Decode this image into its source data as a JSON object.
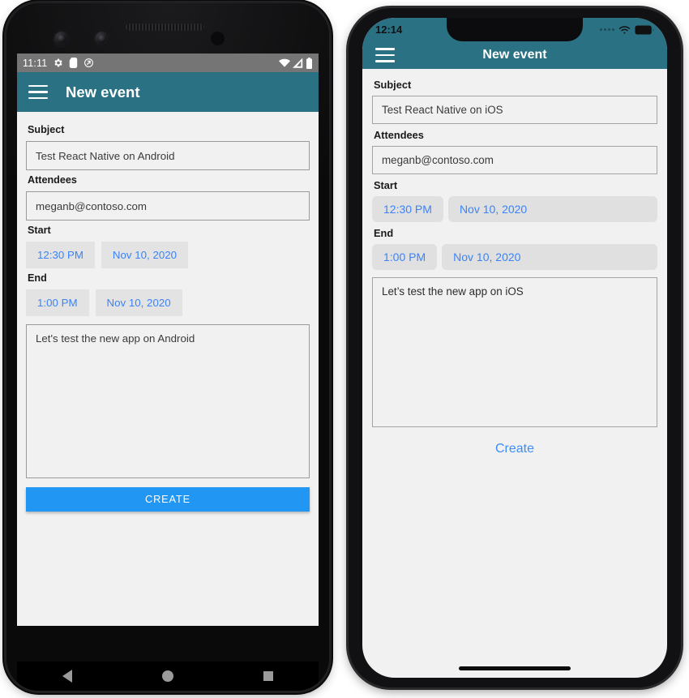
{
  "android": {
    "status_bar": {
      "time": "11:11",
      "left_icons": [
        "settings-gear-icon",
        "sd-card-icon",
        "sync-icon"
      ],
      "right_icons": [
        "wifi-icon",
        "cellular-signal-icon",
        "battery-icon"
      ]
    },
    "app_bar": {
      "menu_icon": "hamburger-menu-icon",
      "title": "New event"
    },
    "form": {
      "subject_label": "Subject",
      "subject_value": "Test React Native on Android",
      "attendees_label": "Attendees",
      "attendees_value": "meganb@contoso.com",
      "start_label": "Start",
      "start_time": "12:30 PM",
      "start_date": "Nov 10, 2020",
      "end_label": "End",
      "end_time": "1:00 PM",
      "end_date": "Nov 10, 2020",
      "body_value": "Let's test the new app on Android",
      "create_label": "CREATE"
    },
    "nav_bar": {
      "back_icon": "back-triangle-icon",
      "home_icon": "home-circle-icon",
      "recents_icon": "recents-square-icon"
    }
  },
  "ios": {
    "status_bar": {
      "time": "12:14",
      "right_icons": [
        "cellular-dots-icon",
        "wifi-icon",
        "battery-icon"
      ]
    },
    "nav_bar": {
      "menu_icon": "hamburger-menu-icon",
      "title": "New event"
    },
    "form": {
      "subject_label": "Subject",
      "subject_value": "Test React Native on iOS",
      "attendees_label": "Attendees",
      "attendees_value": "meganb@contoso.com",
      "start_label": "Start",
      "start_time": "12:30 PM",
      "start_date": "Nov 10, 2020",
      "end_label": "End",
      "end_time": "1:00 PM",
      "end_date": "Nov 10, 2020",
      "body_value": "Let’s test the new app on iOS",
      "create_label": "Create"
    }
  },
  "colors": {
    "header_teal": "#2a7184",
    "accent_blue": "#3b83f7",
    "android_button_blue": "#2196f3",
    "chip_grey": "#e3e3e3",
    "screen_bg": "#f1f1f1",
    "android_status_grey": "#757575"
  }
}
